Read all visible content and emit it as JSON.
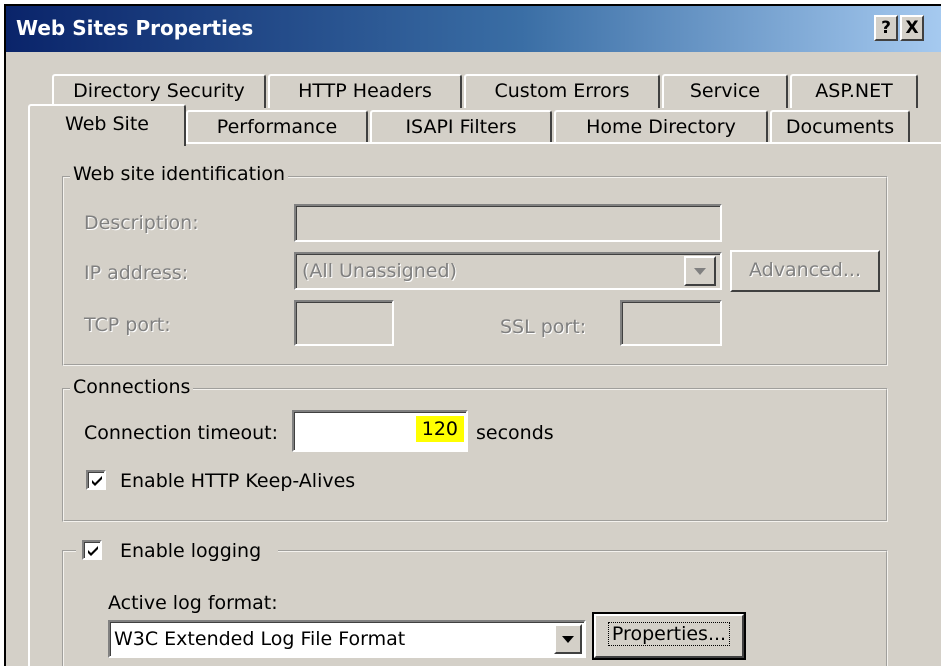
{
  "window": {
    "title": "Web Sites Properties",
    "help_label": "?",
    "close_label": "X"
  },
  "tabs": {
    "row1": [
      {
        "label": "Directory Security"
      },
      {
        "label": "HTTP Headers"
      },
      {
        "label": "Custom Errors"
      },
      {
        "label": "Service"
      },
      {
        "label": "ASP.NET"
      }
    ],
    "row2": [
      {
        "label": "Web Site",
        "active": true
      },
      {
        "label": "Performance"
      },
      {
        "label": "ISAPI Filters"
      },
      {
        "label": "Home Directory"
      },
      {
        "label": "Documents"
      }
    ]
  },
  "identification": {
    "group_label": "Web site identification",
    "description_label": "Description:",
    "description_value": "",
    "ip_label": "IP address:",
    "ip_value": "(All Unassigned)",
    "advanced_label": "Advanced...",
    "tcp_label": "TCP port:",
    "tcp_value": "",
    "ssl_label": "SSL port:",
    "ssl_value": ""
  },
  "connections": {
    "group_label": "Connections",
    "timeout_label": "Connection timeout:",
    "timeout_value": "120",
    "timeout_unit": "seconds",
    "keepalive_label": "Enable HTTP Keep-Alives",
    "keepalive_checked": true
  },
  "logging": {
    "enable_label": "Enable logging",
    "enable_checked": true,
    "format_label": "Active log format:",
    "format_value": "W3C Extended Log File Format",
    "properties_label": "Properties..."
  },
  "colors": {
    "titlebar_start": "#0a246a",
    "titlebar_end": "#a6caf0",
    "face": "#d4d0c8",
    "highlight_value": "#ffff00"
  }
}
